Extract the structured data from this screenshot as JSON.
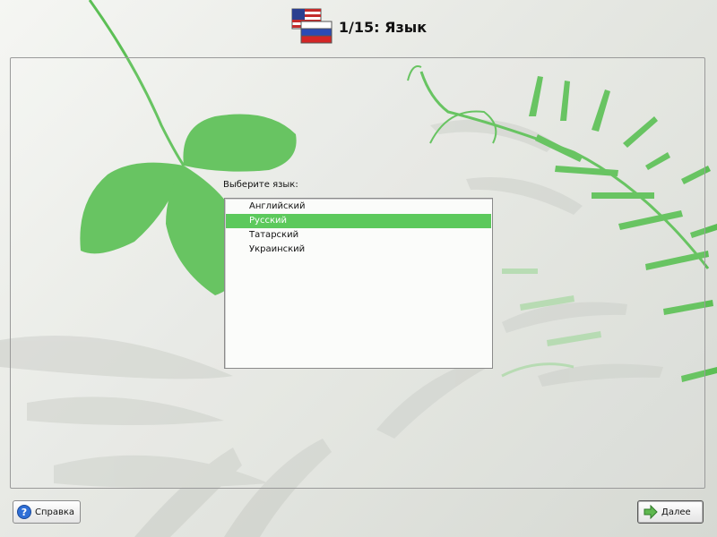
{
  "header": {
    "title": "1/15: Язык",
    "icon": "flags-icon"
  },
  "language_prompt": "Выберите язык:",
  "languages": [
    {
      "label": "Английский",
      "selected": false
    },
    {
      "label": "Русский",
      "selected": true
    },
    {
      "label": "Татарский",
      "selected": false
    },
    {
      "label": "Украинский",
      "selected": false
    }
  ],
  "buttons": {
    "help_label": "Справка",
    "help_icon": "help-icon",
    "next_label": "Далее",
    "next_icon": "arrow-right-icon"
  },
  "colors": {
    "selection": "#5cc95c",
    "leaf_green": "#5cbf55"
  }
}
